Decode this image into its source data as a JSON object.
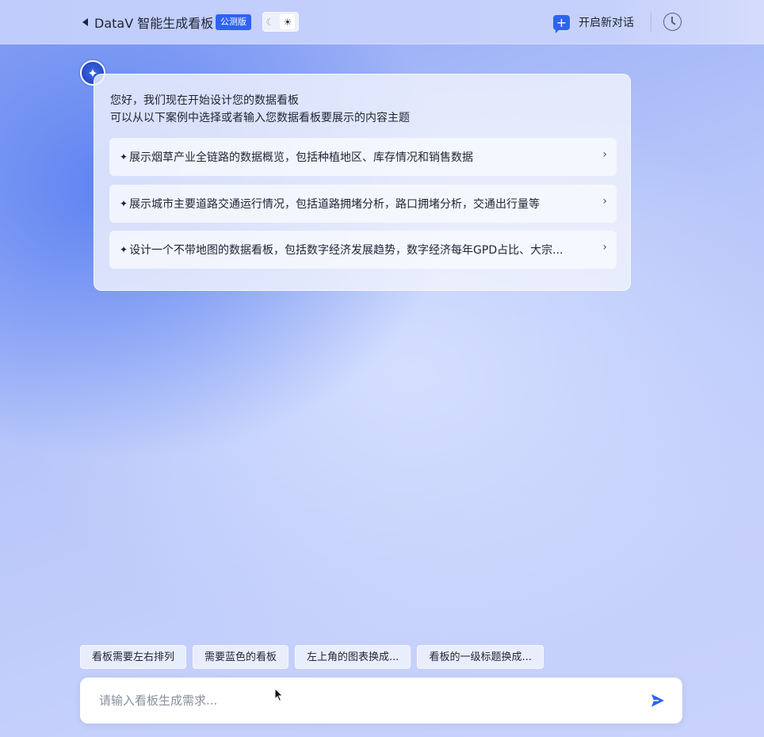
{
  "header": {
    "title": "DataV 智能生成看板",
    "badge": "公测版",
    "theme_moon": "☾",
    "theme_sun": "☀",
    "new_chat_label": "开启新对话",
    "new_chat_glyph": "+"
  },
  "assistant": {
    "avatar_glyph": "✦",
    "greeting_line1": "您好，我们现在开始设计您的数据看板",
    "greeting_line2": "可以从以下案例中选择或者输入您数据看板要展示的内容主题",
    "suggestions": [
      {
        "text": "展示烟草产业全链路的数据概览，包括种植地区、库存情况和销售数据"
      },
      {
        "text": "展示城市主要道路交通运行情况，包括道路拥堵分析，路口拥堵分析，交通出行量等"
      },
      {
        "text": "设计一个不带地图的数据看板，包括数字经济发展趋势，数字经济每年GPD占比、大宗..."
      }
    ],
    "sparkle_glyph": "✦",
    "chevron_glyph": "›"
  },
  "chips": [
    "看板需要左右排列",
    "需要蓝色的看板",
    "左上角的图表换成...",
    "看板的一级标题换成..."
  ],
  "input": {
    "placeholder": "请输入看板生成需求...",
    "value": ""
  },
  "colors": {
    "accent": "#2e62f0",
    "text": "#1f2433"
  }
}
